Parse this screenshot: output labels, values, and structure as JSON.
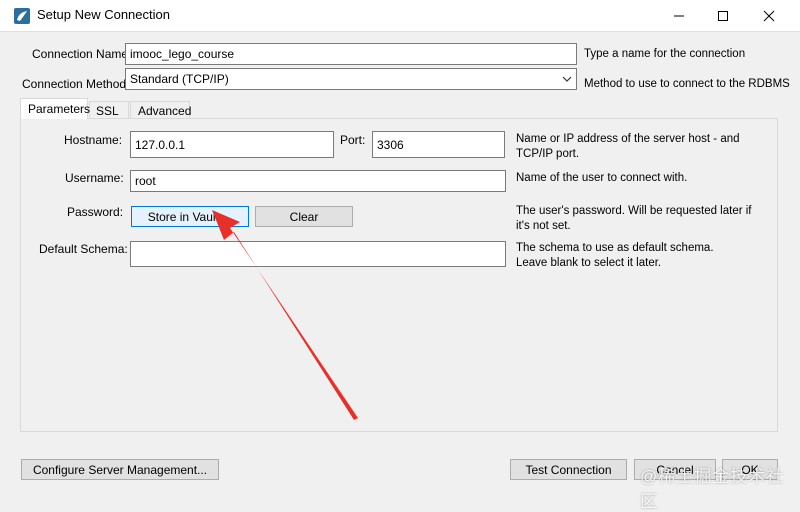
{
  "window": {
    "title": "Setup New Connection",
    "minimize_icon": "minimize-icon",
    "maximize_icon": "maximize-icon",
    "close_icon": "close-icon"
  },
  "connection": {
    "name_label": "Connection Name:",
    "name_value": "imooc_lego_course",
    "name_help": "Type a name for the connection",
    "method_label": "Connection Method:",
    "method_value": "Standard (TCP/IP)",
    "method_help": "Method to use to connect to the RDBMS"
  },
  "tabs": [
    {
      "label": "Parameters",
      "active": true
    },
    {
      "label": "SSL",
      "active": false
    },
    {
      "label": "Advanced",
      "active": false
    }
  ],
  "params": {
    "hostname_label": "Hostname:",
    "hostname_value": "127.0.0.1",
    "port_label": "Port:",
    "port_value": "3306",
    "hostname_help": "Name or IP address of the server host - and TCP/IP port.",
    "username_label": "Username:",
    "username_value": "root",
    "username_help": "Name of the user to connect with.",
    "password_label": "Password:",
    "store_vault_label": "Store in Vault ...",
    "clear_label": "Clear",
    "password_help": "The user's password. Will be requested later if it's not set.",
    "schema_label": "Default Schema:",
    "schema_value": "",
    "schema_help": "The schema to use as default schema. Leave blank to select it later."
  },
  "footer": {
    "configure_label": "Configure Server Management...",
    "test_label": "Test Connection",
    "cancel_label": "Cancel",
    "ok_label": "OK"
  },
  "watermark": "@稀土掘金技术社区",
  "colors": {
    "annotation_arrow": "#e8302a",
    "focus_border": "#0078d7"
  }
}
